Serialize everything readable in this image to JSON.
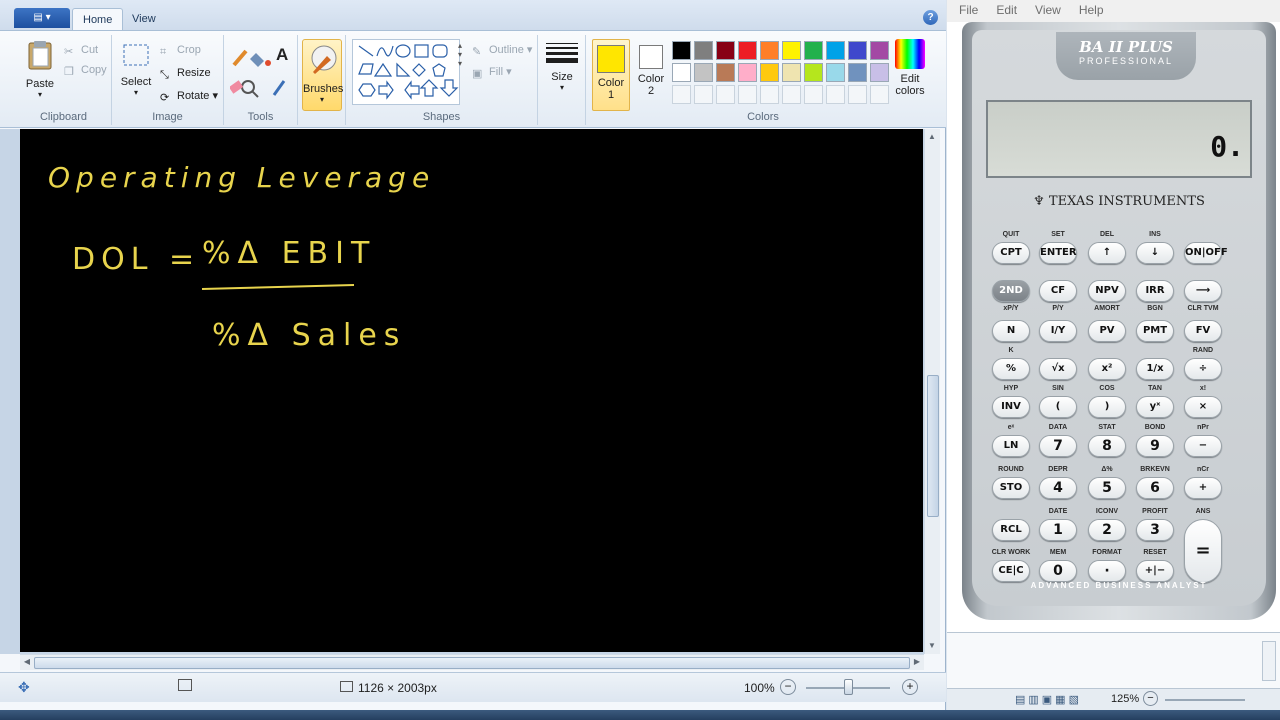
{
  "paint": {
    "app_menu_icon": "app-menu-icon",
    "tabs": [
      "Home",
      "View"
    ],
    "clipboard": {
      "paste": "Paste",
      "cut": "Cut",
      "copy": "Copy",
      "label": "Clipboard"
    },
    "image": {
      "select": "Select",
      "crop": "Crop",
      "resize": "Resize",
      "rotate": "Rotate",
      "label": "Image"
    },
    "tools": {
      "label": "Tools",
      "text_tool": "A"
    },
    "brushes": {
      "label": "Brushes"
    },
    "shapes": {
      "outline": "Outline",
      "fill": "Fill",
      "label": "Shapes"
    },
    "size": {
      "label": "Size"
    },
    "colors": {
      "color1_label": "Color",
      "color1_num": "1",
      "color1_value": "#ffe600",
      "color2_label": "Color",
      "color2_num": "2",
      "color2_value": "#ffffff",
      "edit_label_1": "Edit",
      "edit_label_2": "colors",
      "group_label": "Colors",
      "palette_row1": [
        "#000000",
        "#7f7f7f",
        "#880015",
        "#ed1c24",
        "#ff7f27",
        "#fff200",
        "#22b14c",
        "#00a2e8",
        "#3f48cc",
        "#a349a4"
      ],
      "palette_row2": [
        "#ffffff",
        "#c3c3c3",
        "#b97a57",
        "#ffaec9",
        "#ffc90e",
        "#efe4b0",
        "#b5e61d",
        "#99d9ea",
        "#7092be",
        "#c8bfe7"
      ]
    },
    "canvas": {
      "title_text": "Operating Leverage",
      "formula_lhs": "DOL =",
      "numerator": "%Δ EBIT",
      "denominator": "%Δ Sales",
      "ink_color": "#e8d44d"
    },
    "status": {
      "dimensions": "1126 × 2003px",
      "zoom": "100%"
    }
  },
  "calculator": {
    "menu": [
      "File",
      "Edit",
      "View",
      "Help"
    ],
    "model_name": "BA II PLUS",
    "model_sub": "PROFESSIONAL",
    "display_value": "0.",
    "brand": "TEXAS INSTRUMENTS",
    "footer": "ADVANCED BUSINESS ANALYST",
    "secondary": {
      "quit": "QUIT",
      "set": "SET",
      "del": "DEL",
      "ins": "INS",
      "xpy": "xP/Y",
      "py": "P/Y",
      "amort": "AMORT",
      "bgn": "BGN",
      "clrtvm": "CLR TVM",
      "k": "K",
      "rand": "RAND",
      "hyp": "HYP",
      "sin": "SIN",
      "cos": "COS",
      "tan": "TAN",
      "xfact": "x!",
      "ex": "eˣ",
      "data": "DATA",
      "stat": "STAT",
      "bond": "BOND",
      "npr": "nPr",
      "round": "ROUND",
      "depr": "DEPR",
      "dpct": "Δ%",
      "brkevn": "BRKEVN",
      "ncr": "nCr",
      "date": "DATE",
      "iconv": "ICONV",
      "profit": "PROFIT",
      "ans": "ANS",
      "clrwork": "CLR WORK",
      "mem": "MEM",
      "format": "FORMAT",
      "reset": "RESET"
    },
    "keys": {
      "cpt": "CPT",
      "enter": "ENTER",
      "up": "↑",
      "down": "↓",
      "onoff": "ON|OFF",
      "second": "2ND",
      "cf": "CF",
      "npv": "NPV",
      "irr": "IRR",
      "arrow": "⟶",
      "n": "N",
      "iy": "I/Y",
      "pv": "PV",
      "pmt": "PMT",
      "fv": "FV",
      "pct": "%",
      "sqrt": "√x",
      "sq": "x²",
      "recip": "1/x",
      "div": "÷",
      "inv": "INV",
      "lpar": "(",
      "rpar": ")",
      "pow": "yˣ",
      "mul": "×",
      "ln": "LN",
      "k7": "7",
      "k8": "8",
      "k9": "9",
      "minus": "−",
      "sto": "STO",
      "k4": "4",
      "k5": "5",
      "k6": "6",
      "plus": "+",
      "rcl": "RCL",
      "k1": "1",
      "k2": "2",
      "k3": "3",
      "eq": "=",
      "cec": "CE|C",
      "k0": "0",
      "dot": "·",
      "sign": "+|−"
    },
    "zoom": "125%"
  }
}
